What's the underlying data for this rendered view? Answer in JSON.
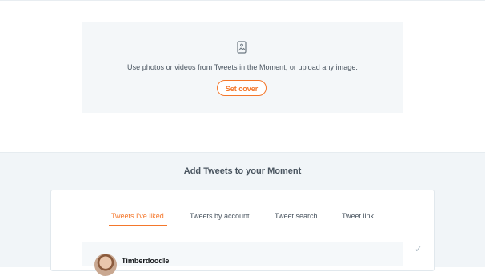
{
  "cover": {
    "icon": "image-icon",
    "text": "Use photos or videos from Tweets in the Moment, or upload any image.",
    "button_label": "Set cover"
  },
  "add_tweets": {
    "title": "Add Tweets to your Moment",
    "tabs": [
      {
        "label": "Tweets I've liked",
        "active": true
      },
      {
        "label": "Tweets by account",
        "active": false
      },
      {
        "label": "Tweet search",
        "active": false
      },
      {
        "label": "Tweet link",
        "active": false
      }
    ],
    "tweets": [
      {
        "author": "Timberdoodle",
        "avatar": "avatar"
      }
    ],
    "check_icon": "check-icon"
  },
  "colors": {
    "accent": "#f4772b",
    "text_secondary": "#4a5560",
    "panel_bg": "#f4f7f9"
  }
}
